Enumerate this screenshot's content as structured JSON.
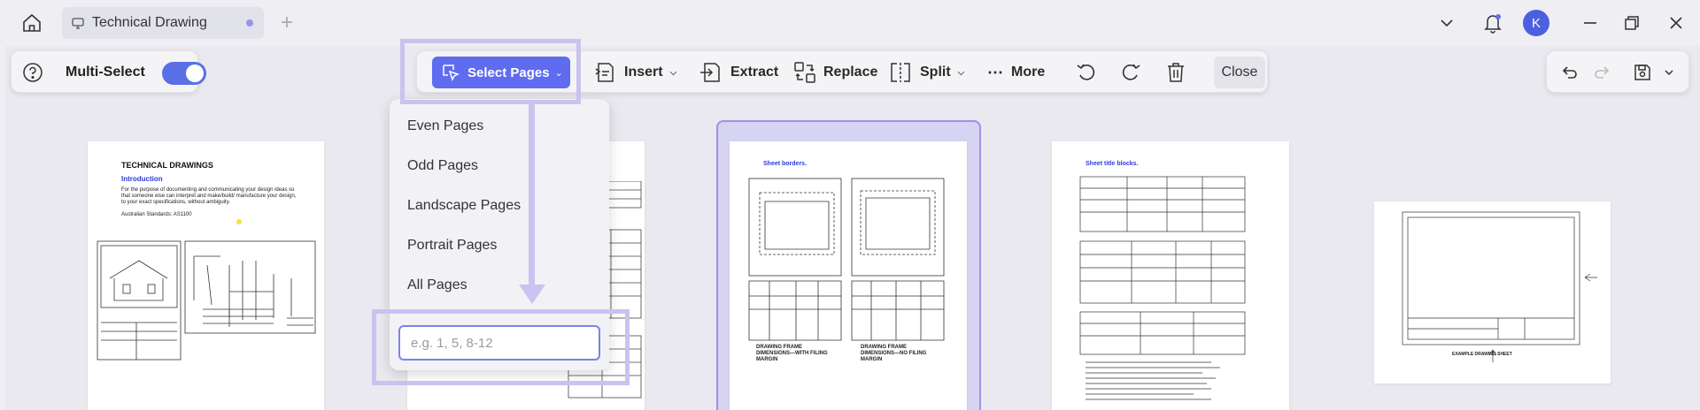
{
  "tab": {
    "title": "Technical Drawing",
    "new_tab_symbol": "+"
  },
  "user": {
    "avatar_initial": "K"
  },
  "left_panel": {
    "multi_select_label": "Multi-Select",
    "multi_select_on": true
  },
  "toolbar": {
    "select_pages_label": "Select Pages",
    "insert_label": "Insert",
    "extract_label": "Extract",
    "replace_label": "Replace",
    "split_label": "Split",
    "more_label": "More",
    "close_label": "Close"
  },
  "dropdown": {
    "items": [
      "Even Pages",
      "Odd Pages",
      "Landscape Pages",
      "Portrait Pages",
      "All Pages"
    ],
    "range_placeholder": "e.g. 1, 5, 8-12"
  },
  "pages": {
    "p1": {
      "title": "TECHNICAL DRAWINGS",
      "subtitle": "Introduction",
      "body": "For the purpose of documenting and communicating your design ideas so that someone else can interpret and make/build/ manufacture your design, to your exact specifications, without ambiguity.",
      "standard": "Australian Standards:  AS1100"
    },
    "p3": {
      "heading": "Sheet borders.",
      "caption_left": "DRAWING FRAME DIMENSIONS—WITH FILING MARGIN",
      "caption_right": "DRAWING FRAME DIMENSIONS—NO FILING MARGIN"
    },
    "p4": {
      "heading": "Sheet title blocks."
    },
    "p5": {
      "caption": "EXAMPLE DRAWING SHEET"
    }
  },
  "colors": {
    "accent": "#5f6cf0",
    "highlight": "#c8c3ef",
    "selection": "#d6d3f3",
    "avatar": "#4b5fe0"
  }
}
